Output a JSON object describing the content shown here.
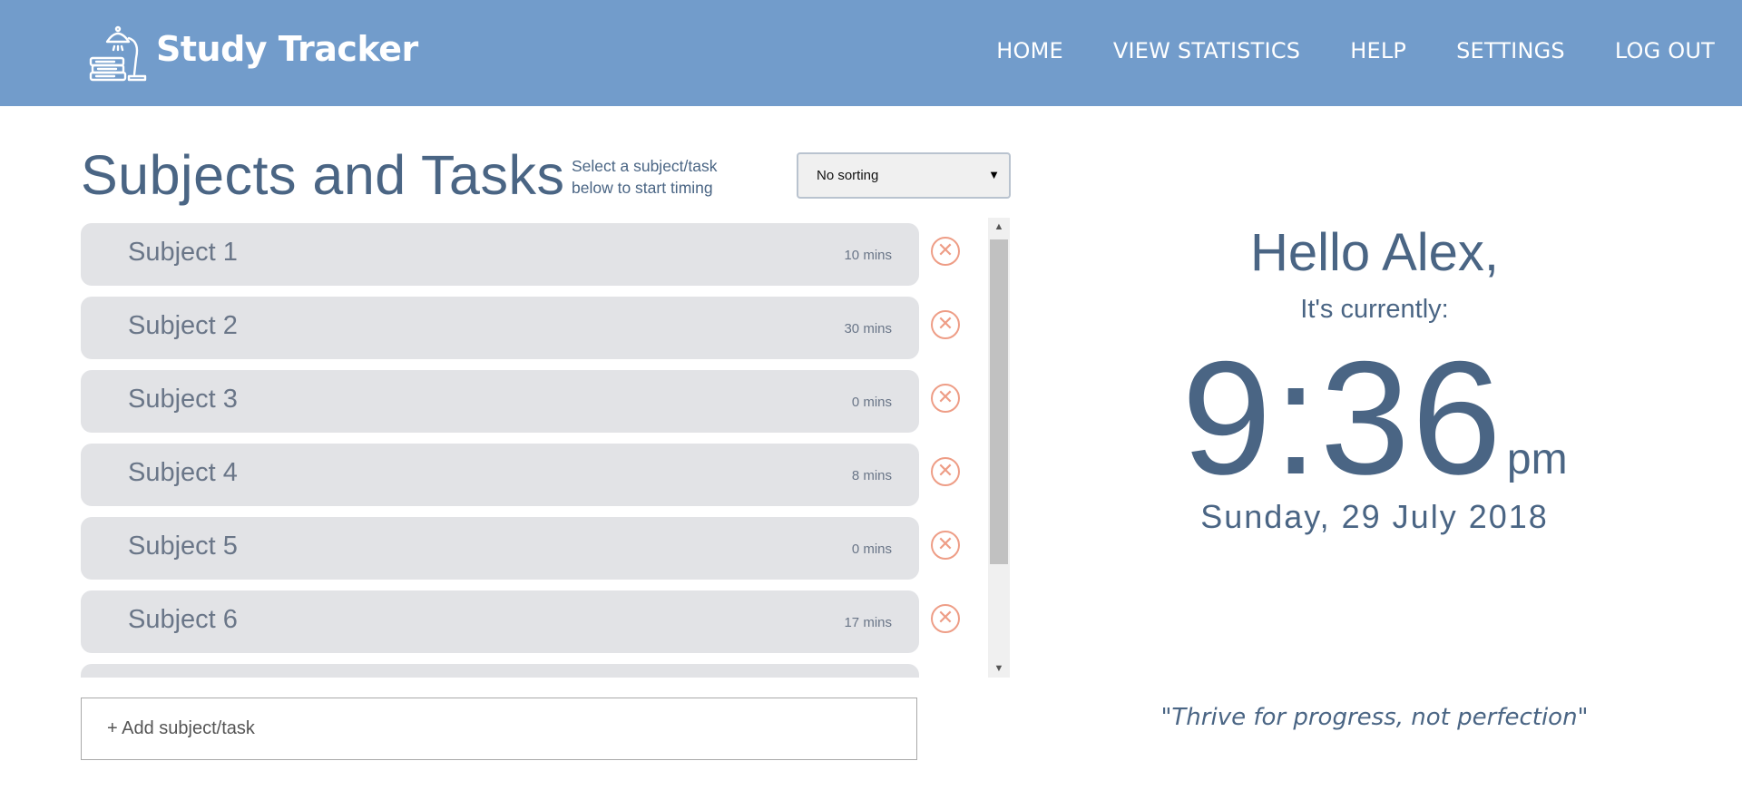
{
  "header": {
    "brand": "Study Tracker",
    "logo_icon": "lamp-books-icon",
    "nav": [
      {
        "label": "HOME"
      },
      {
        "label": "VIEW STATISTICS"
      },
      {
        "label": "HELP"
      },
      {
        "label": "SETTINGS"
      },
      {
        "label": "LOG OUT"
      }
    ],
    "background_color": "#729ccb"
  },
  "tasks_panel": {
    "title": "Subjects and Tasks",
    "hint": "Select a subject/task below to start timing",
    "sort": {
      "selected": "No sorting"
    },
    "items": [
      {
        "name": "Subject 1",
        "time": "10 mins"
      },
      {
        "name": "Subject 2",
        "time": "30 mins"
      },
      {
        "name": "Subject 3",
        "time": "0 mins"
      },
      {
        "name": "Subject 4",
        "time": "8 mins"
      },
      {
        "name": "Subject 5",
        "time": "0 mins"
      },
      {
        "name": "Subject 6",
        "time": "17 mins"
      }
    ],
    "add_placeholder": "+ Add subject/task"
  },
  "clock_panel": {
    "greeting": "Hello Alex,",
    "currently": "It's currently:",
    "time": "9:36",
    "ampm": "pm",
    "date": "Sunday, 29 July 2018",
    "quote": "\"Thrive for progress, not perfection\""
  }
}
